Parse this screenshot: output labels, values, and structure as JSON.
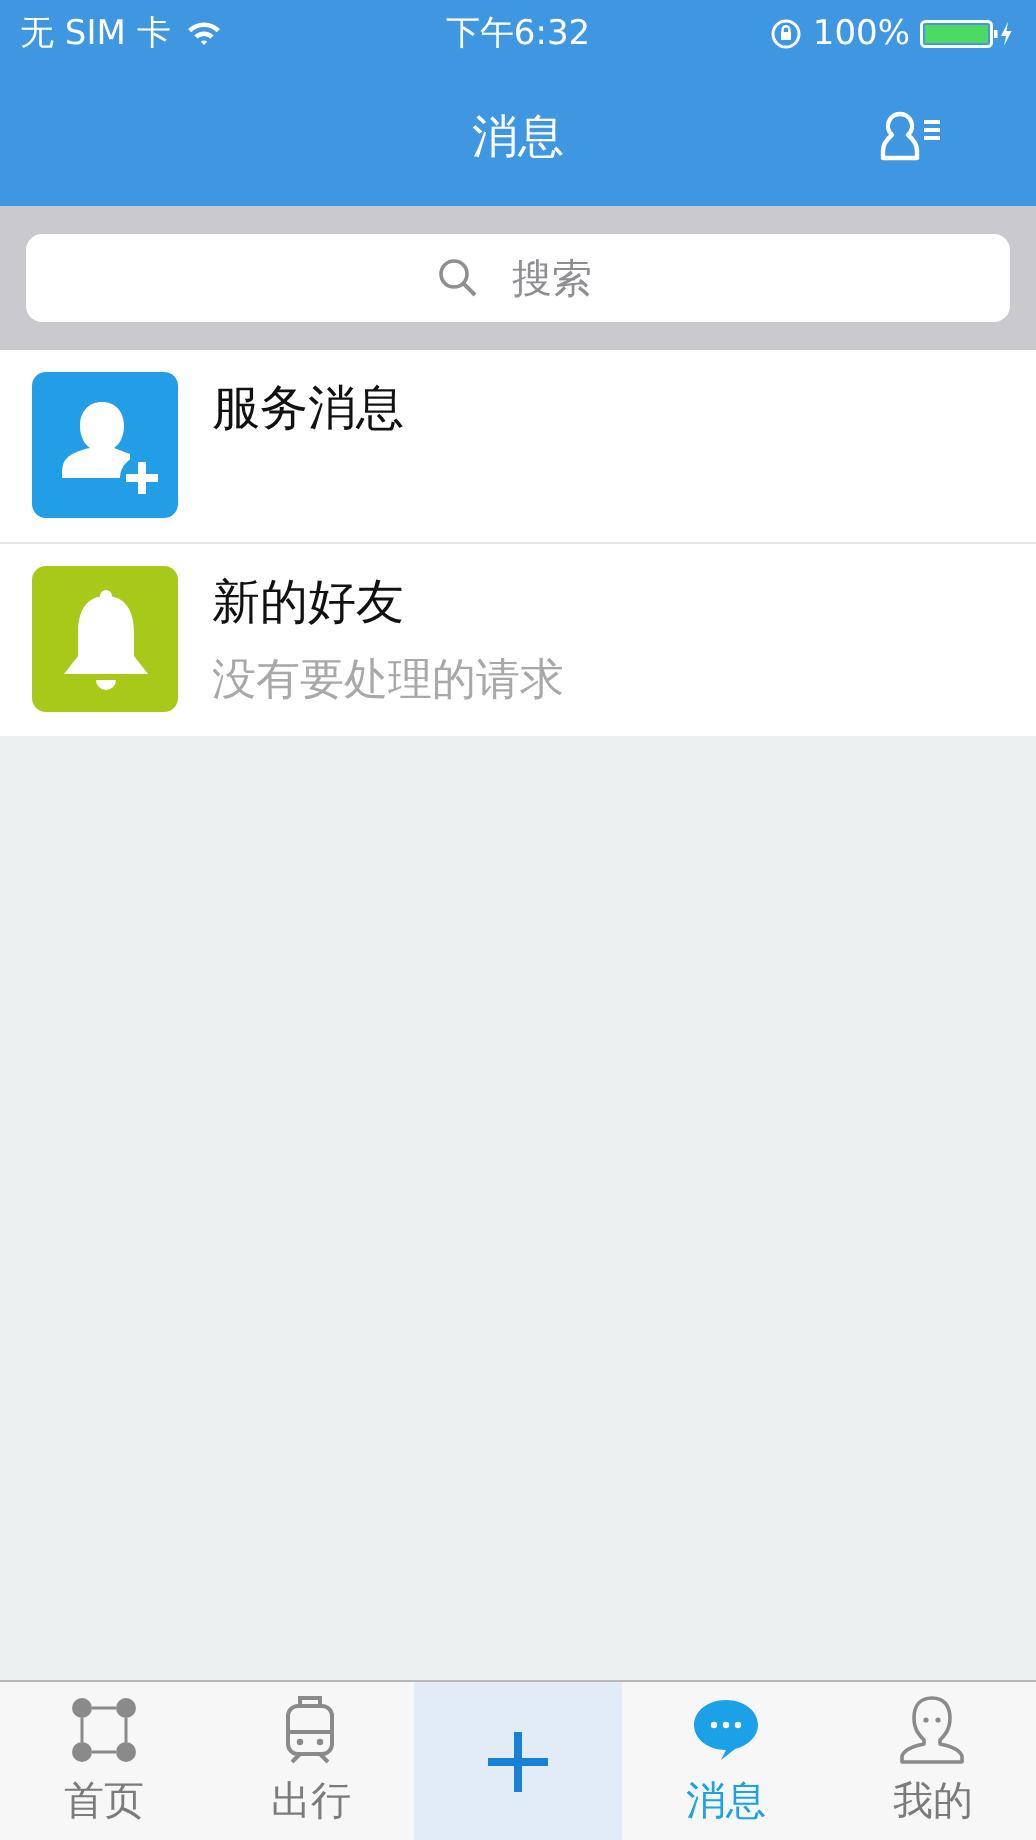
{
  "status_bar": {
    "carrier": "无 SIM 卡",
    "time": "下午6:32",
    "battery": "100%"
  },
  "nav": {
    "title": "消息"
  },
  "search": {
    "placeholder": "搜索"
  },
  "messages": [
    {
      "title": "服务消息",
      "color": "#229ee6"
    },
    {
      "title": "新的好友",
      "subtitle": "没有要处理的请求",
      "color": "#a8c81a"
    }
  ],
  "tabs": [
    {
      "kind": "tab",
      "label": "首页",
      "selected": false
    },
    {
      "kind": "tab",
      "label": "出行",
      "selected": false
    },
    {
      "kind": "add",
      "selected": false
    },
    {
      "kind": "tab",
      "label": "消息",
      "selected": true
    },
    {
      "kind": "tab",
      "label": "我的",
      "selected": false
    }
  ]
}
